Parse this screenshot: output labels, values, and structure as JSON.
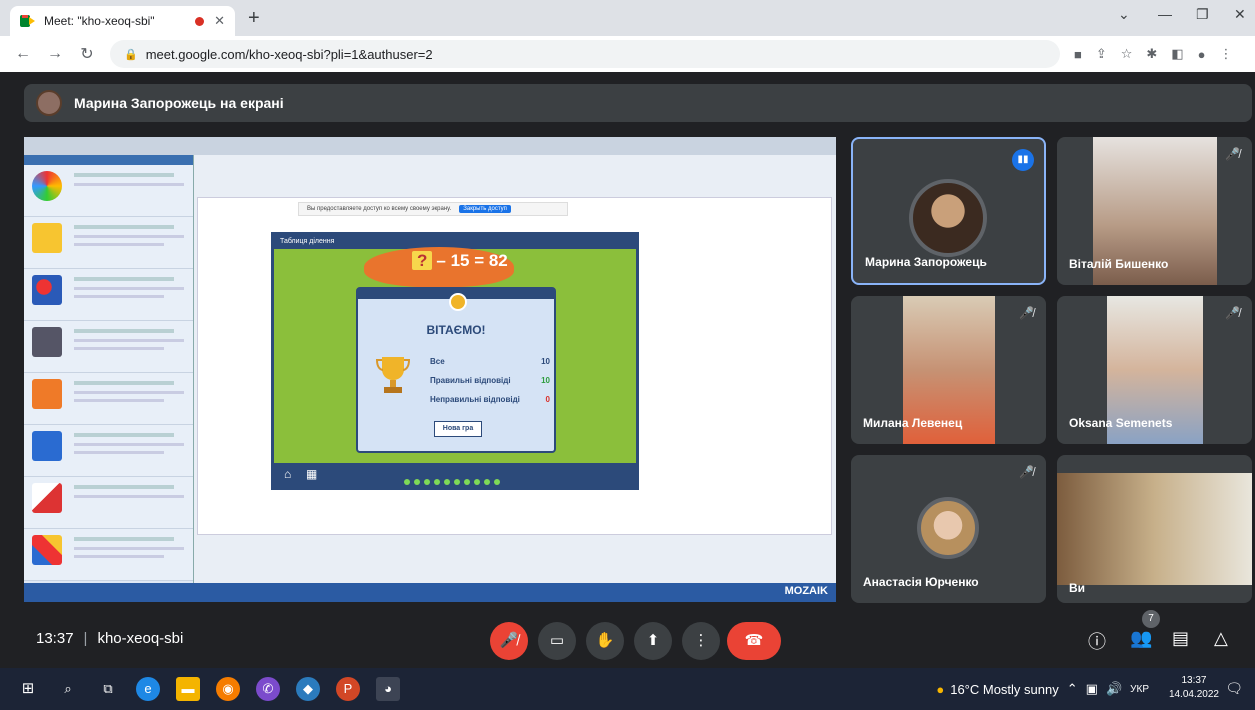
{
  "browser": {
    "tab_title": "Meet: \"kho-xeoq-sbi\"",
    "url": "meet.google.com/kho-xeoq-sbi?pli=1&authuser=2"
  },
  "banner": {
    "text": "Марина Запорожець на екрані"
  },
  "presentation": {
    "share_notice": "Вы предоставляете доступ ко всему своему экрану.",
    "share_stop": "Закрыть доступ",
    "game_window": "Таблиця ділення",
    "equation_unknown": "?",
    "equation_rest": "– 15 = 82",
    "dialog_title": "ВІТАЄМО!",
    "rows": [
      {
        "label": "Все",
        "value": "10",
        "color": "#2c4a7a"
      },
      {
        "label": "Правильні відповіді",
        "value": "10",
        "color": "#2e9d3f"
      },
      {
        "label": "Неправильні відповіді",
        "value": "0",
        "color": "#d9302a"
      }
    ],
    "new_game": "Нова гра",
    "side_brand": "MOZAIK"
  },
  "participants": [
    {
      "name": "Марина Запорожець",
      "speaking": true
    },
    {
      "name": "Віталій Бишенко",
      "muted": true
    },
    {
      "name": "Милана Левенец",
      "muted": true
    },
    {
      "name": "Oksana Semenets",
      "muted": true
    },
    {
      "name": "Анастасія Юрченко",
      "muted": true
    },
    {
      "name": "Ви",
      "muted": false
    }
  ],
  "meeting": {
    "time": "13:37",
    "separator": "|",
    "code": "kho-xeoq-sbi",
    "people_count": "7"
  },
  "taskbar": {
    "weather": "16°C Mostly sunny",
    "lang": "УКР",
    "clock_time": "13:37",
    "clock_date": "14.04.2022"
  }
}
